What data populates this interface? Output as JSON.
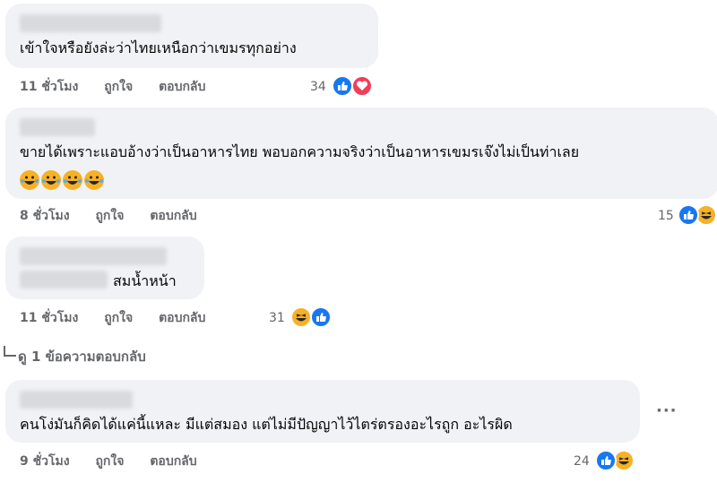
{
  "comments": [
    {
      "text": "เข้าใจหรือยังล่ะว่าไทยเหนือกว่าเขมรทุกอย่าง",
      "time": "11 ชั่วโมง",
      "like_label": "ถูกใจ",
      "reply_label": "ตอบกลับ",
      "reaction_count": "34",
      "reactions": [
        "like-icon",
        "love-icon"
      ]
    },
    {
      "text": "ขายได้เพราะแอบอ้างว่าเป็นอาหารไทย พอบอกความจริงว่าเป็นอาหารเขมรเจ๊งไม่เป็นท่าเลย",
      "emojis": [
        "laugh-tears-emoji",
        "laugh-tears-emoji",
        "laugh-tears-emoji",
        "laugh-tears-emoji"
      ],
      "time": "8 ชั่วโมง",
      "like_label": "ถูกใจ",
      "reply_label": "ตอบกลับ",
      "reaction_count": "15",
      "reactions": [
        "like-icon",
        "haha-icon"
      ]
    },
    {
      "text": "สมน้ำหน้า",
      "time": "11 ชั่วโมง",
      "like_label": "ถูกใจ",
      "reply_label": "ตอบกลับ",
      "reaction_count": "31",
      "reactions": [
        "haha-icon",
        "like-icon"
      ]
    },
    {
      "text": "คนโง่มันก็คิดได้แค่นี้แหละ มีแต่สมอง แต่ไม่มีปัญญาไว้ไตร่ตรองอะไรถูก อะไรผิด",
      "time": "9 ชั่วโมง",
      "like_label": "ถูกใจ",
      "reply_label": "ตอบกลับ",
      "reaction_count": "24",
      "reactions": [
        "like-icon",
        "haha-icon"
      ]
    }
  ],
  "view_replies": "ดู 1 ข้อความตอบกลับ",
  "more_options": "···",
  "colors": {
    "bubble": "#f0f2f5",
    "meta": "#65676b",
    "like": "#1877f2",
    "love": "#f33e58",
    "haha": "#f7b125"
  }
}
